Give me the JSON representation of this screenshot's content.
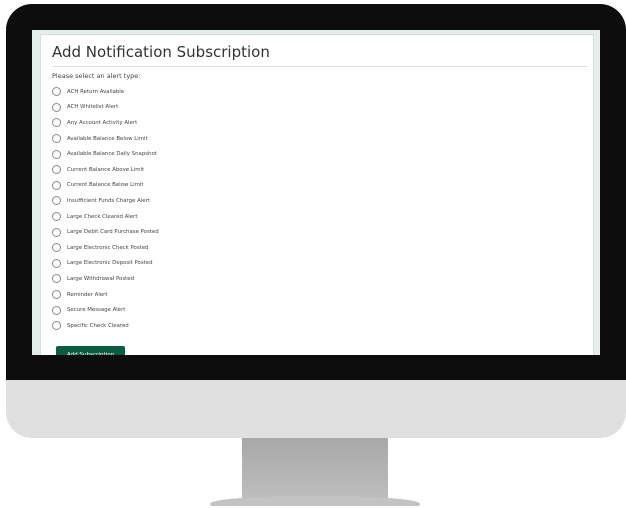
{
  "page": {
    "title": "Add Notification Subscription",
    "prompt": "Please select an alert type:",
    "submit_label": "Add Subscription"
  },
  "alert_types": [
    "ACH Return Available",
    "ACH Whitelist Alert",
    "Any Account Activity Alert",
    "Available Balance Below Limit",
    "Available Balance Daily Snapshot",
    "Current Balance Above Limit",
    "Current Balance Below Limit",
    "Insufficient Funds Charge Alert",
    "Large Check Cleared Alert",
    "Large Debit Card Purchase Posted",
    "Large Electronic Check Posted",
    "Large Electronic Deposit Posted",
    "Large Withdrawal Posted",
    "Reminder Alert",
    "Secure Message Alert",
    "Specific Check Cleared"
  ],
  "colors": {
    "accent": "#0e5c3f",
    "screen_background": "#e4efe9",
    "bezel": "#0d0d0d"
  }
}
